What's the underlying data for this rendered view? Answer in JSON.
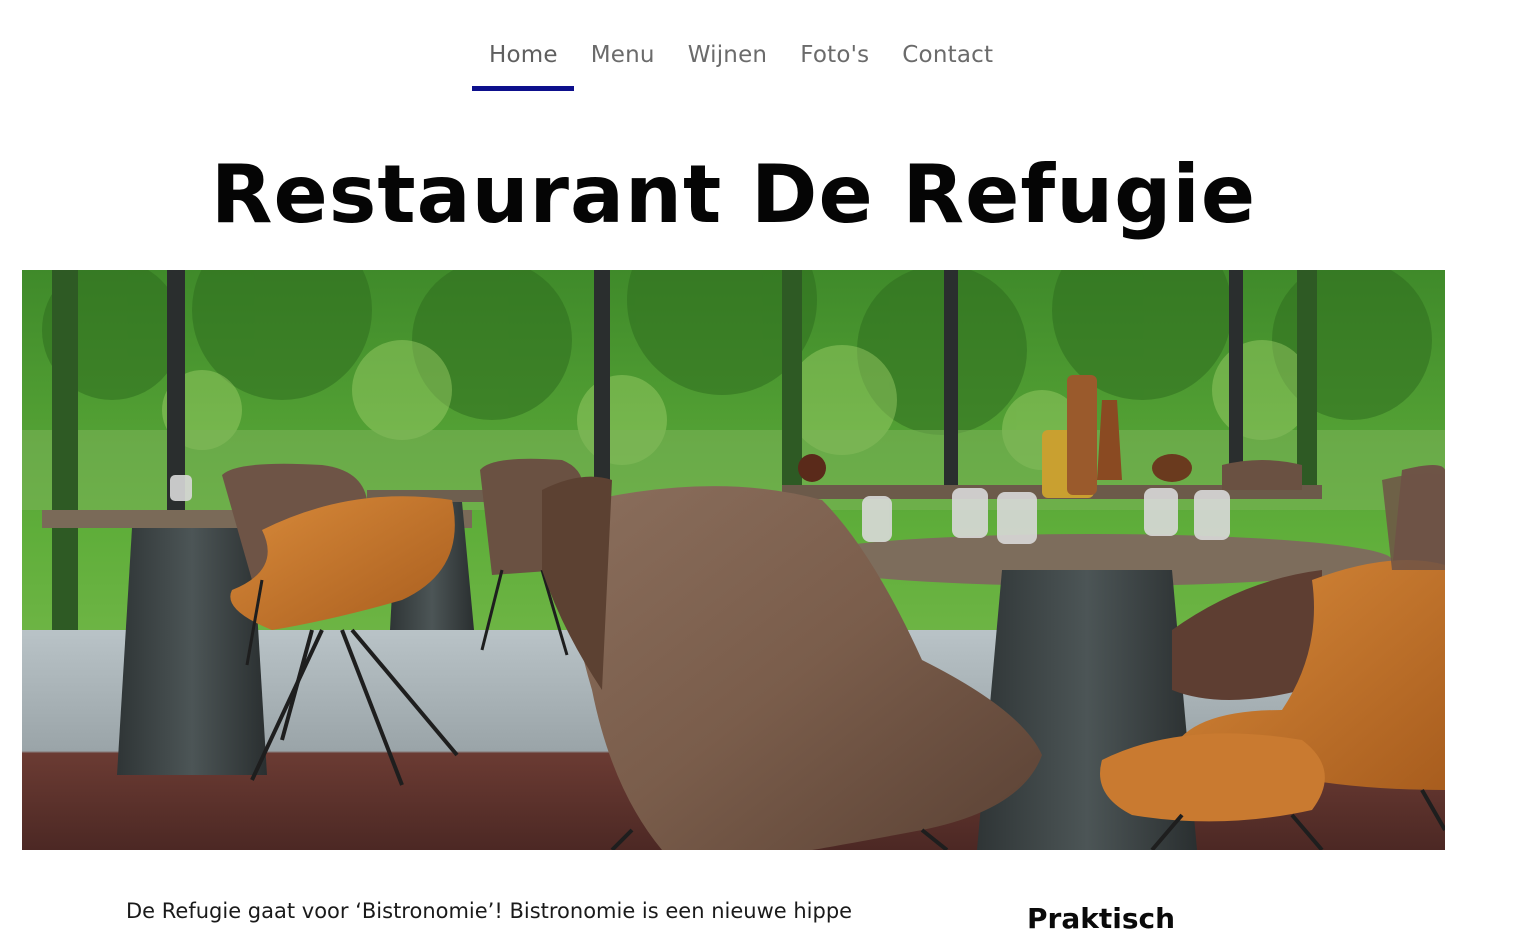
{
  "nav": {
    "items": [
      {
        "label": "Home",
        "active": true
      },
      {
        "label": "Menu",
        "active": false
      },
      {
        "label": "Wijnen",
        "active": false
      },
      {
        "label": "Foto's",
        "active": false
      },
      {
        "label": "Contact",
        "active": false
      }
    ],
    "active_color": "#0d0f8c"
  },
  "page": {
    "title": "Restaurant De Refugie"
  },
  "hero": {
    "image_name": "restaurant-interior-photo"
  },
  "content": {
    "intro_text": "De Refugie gaat voor ‘Bistronomie’! Bistronomie is een nieuwe hippe",
    "sidebar_title": "Praktisch"
  }
}
